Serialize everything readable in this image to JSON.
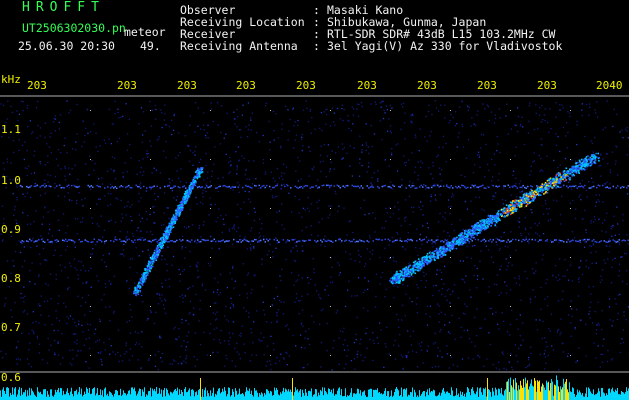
{
  "header": {
    "brand": "HROFFT",
    "filename": "UT2506302030.pn",
    "tag": "meteor",
    "datetime": "25.06.30 20:30",
    "value": "49.",
    "rows": [
      {
        "label": "Observer",
        "value": "Masaki Kano"
      },
      {
        "label": "Receiving Location",
        "value": "Shibukawa, Gunma, Japan"
      },
      {
        "label": "Receiver",
        "value": "RTL-SDR SDR# 43dB L15 103.2MHz CW"
      },
      {
        "label": "Receiving Antenna",
        "value": "3el Yagi(V) Az 330 for Vladivostok"
      }
    ]
  },
  "axes": {
    "y_unit": "kHz",
    "x_ticks": [
      "203",
      "203",
      "203",
      "203",
      "203",
      "203",
      "203",
      "203",
      "203",
      "2040"
    ],
    "y_ticks": [
      "1.1",
      "1.0",
      "0.9",
      "0.8",
      "0.7",
      "0.6"
    ]
  },
  "colors": {
    "header_green": "#33ff55",
    "tick_yellow": "#f0f000",
    "noise_blue": "#1a22b0",
    "signal_cyan": "#00c8ff",
    "peak_yellow": "#ffe000",
    "peak_red": "#ff3020"
  }
}
